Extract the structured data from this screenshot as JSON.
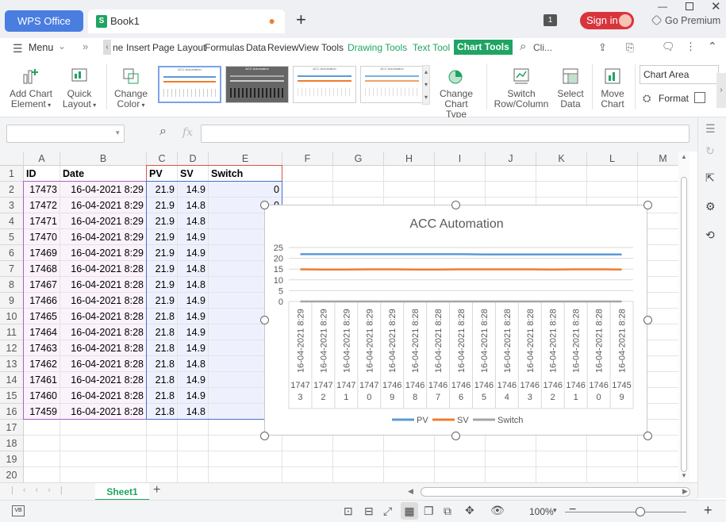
{
  "titlebar": {
    "app_tab": "WPS Office",
    "doc_tab": "Book1",
    "doc_icon": "S",
    "new_tab": "+",
    "badge": "1",
    "signin": "Sign in",
    "premium": "Go Premium"
  },
  "ribbon_tabs": {
    "menu": "Menu",
    "tabs": [
      "ne",
      "Insert",
      "Page Layout",
      "Formulas",
      "Data",
      "Review",
      "View",
      "Tools"
    ],
    "green_tabs": [
      "Drawing Tools",
      "Text Tool"
    ],
    "active_tab": "Chart Tools",
    "search": "Cli..."
  },
  "ribbon": {
    "add_chart_element": [
      "Add Chart",
      "Element"
    ],
    "quick_layout": [
      "Quick",
      "Layout"
    ],
    "change_color": [
      "Change",
      "Color"
    ],
    "change_chart_type": [
      "Change",
      "Chart Type"
    ],
    "switch_row_col": [
      "Switch",
      "Row/Column"
    ],
    "select_data": [
      "Select",
      "Data"
    ],
    "move_chart": [
      "Move",
      "Chart"
    ],
    "chart_area_select": "Chart Area",
    "format": "Format",
    "thumb_titles": [
      "ACC Automation",
      "ACC Automation",
      "ACC Automation",
      "ACC Automation"
    ]
  },
  "formula_bar": {
    "fx": "fx",
    "name_box": "",
    "content": ""
  },
  "sheet": {
    "columns": [
      "A",
      "B",
      "C",
      "D",
      "E",
      "F",
      "G",
      "H",
      "I",
      "J",
      "K",
      "L",
      "M"
    ],
    "rows": [
      "1",
      "2",
      "3",
      "4",
      "5",
      "6",
      "7",
      "8",
      "9",
      "10",
      "11",
      "12",
      "13",
      "14",
      "15",
      "16",
      "17",
      "18",
      "19",
      "20"
    ],
    "headers": [
      "ID",
      "Date",
      "PV",
      "SV",
      "Switch"
    ],
    "data": [
      [
        "17473",
        "16-04-2021 8:29",
        "21.9",
        "14.9",
        "0"
      ],
      [
        "17472",
        "16-04-2021 8:29",
        "21.9",
        "14.8",
        "0"
      ],
      [
        "17471",
        "16-04-2021 8:29",
        "21.9",
        "14.8",
        "0"
      ],
      [
        "17470",
        "16-04-2021 8:29",
        "21.9",
        "14.9",
        "0"
      ],
      [
        "17469",
        "16-04-2021 8:29",
        "21.9",
        "14.9",
        "0"
      ],
      [
        "17468",
        "16-04-2021 8:28",
        "21.9",
        "14.8",
        "0"
      ],
      [
        "17467",
        "16-04-2021 8:28",
        "21.9",
        "14.8",
        "0"
      ],
      [
        "17466",
        "16-04-2021 8:28",
        "21.9",
        "14.9",
        "0"
      ],
      [
        "17465",
        "16-04-2021 8:28",
        "21.8",
        "14.9",
        "0"
      ],
      [
        "17464",
        "16-04-2021 8:28",
        "21.8",
        "14.9",
        "0"
      ],
      [
        "17463",
        "16-04-2021 8:28",
        "21.8",
        "14.9",
        "0"
      ],
      [
        "17462",
        "16-04-2021 8:28",
        "21.8",
        "14.8",
        "0"
      ],
      [
        "17461",
        "16-04-2021 8:28",
        "21.8",
        "14.9",
        "0"
      ],
      [
        "17460",
        "16-04-2021 8:28",
        "21.8",
        "14.9",
        "0"
      ],
      [
        "17459",
        "16-04-2021 8:28",
        "21.8",
        "14.8",
        "0"
      ]
    ],
    "sheet_tab": "Sheet1",
    "add_sheet": "+"
  },
  "status": {
    "zoom": "100%",
    "zoom_fraction": 0.58
  },
  "chart_data": {
    "type": "line",
    "title": "ACC Automation",
    "categories": [
      [
        "16-04-2021 8:29",
        "1747",
        "3"
      ],
      [
        "16-04-2021 8:29",
        "1747",
        "2"
      ],
      [
        "16-04-2021 8:29",
        "1747",
        "1"
      ],
      [
        "16-04-2021 8:29",
        "1747",
        "0"
      ],
      [
        "16-04-2021 8:29",
        "1746",
        "9"
      ],
      [
        "16-04-2021 8:28",
        "1746",
        "8"
      ],
      [
        "16-04-2021 8:28",
        "1746",
        "7"
      ],
      [
        "16-04-2021 8:28",
        "1746",
        "6"
      ],
      [
        "16-04-2021 8:28",
        "1746",
        "5"
      ],
      [
        "16-04-2021 8:28",
        "1746",
        "4"
      ],
      [
        "16-04-2021 8:28",
        "1746",
        "3"
      ],
      [
        "16-04-2021 8:28",
        "1746",
        "2"
      ],
      [
        "16-04-2021 8:28",
        "1746",
        "1"
      ],
      [
        "16-04-2021 8:28",
        "1746",
        "0"
      ],
      [
        "16-04-2021 8:28",
        "1745",
        "9"
      ]
    ],
    "series": [
      {
        "name": "PV",
        "color": "#5b9bd5",
        "values": [
          21.9,
          21.9,
          21.9,
          21.9,
          21.9,
          21.9,
          21.9,
          21.9,
          21.8,
          21.8,
          21.8,
          21.8,
          21.8,
          21.8,
          21.8
        ]
      },
      {
        "name": "SV",
        "color": "#ed7d31",
        "values": [
          14.9,
          14.8,
          14.8,
          14.9,
          14.9,
          14.8,
          14.8,
          14.9,
          14.9,
          14.9,
          14.9,
          14.8,
          14.9,
          14.9,
          14.8
        ]
      },
      {
        "name": "Switch",
        "color": "#a5a5a5",
        "values": [
          0,
          0,
          0,
          0,
          0,
          0,
          0,
          0,
          0,
          0,
          0,
          0,
          0,
          0,
          0
        ]
      }
    ],
    "yticks": [
      "25",
      "20",
      "15",
      "10",
      "5",
      "0"
    ],
    "ylim": [
      0,
      25
    ],
    "grid": true,
    "legend": "bottom"
  }
}
